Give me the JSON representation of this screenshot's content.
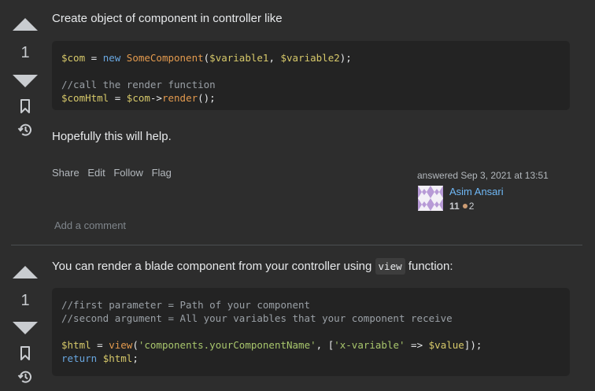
{
  "answers": [
    {
      "vote_count": "1",
      "intro_text": "Create object of component in controller like",
      "code_lines": [
        "$com = new SomeComponent($variable1, $variable2);",
        "",
        "//call the render function",
        "$comHtml = $com->render();"
      ],
      "outro_text": "Hopefully this will help.",
      "post_menu": [
        "Share",
        "Edit",
        "Follow",
        "Flag"
      ],
      "user": {
        "action": "answered Sep 3, 2021 at 13:51",
        "name": "Asim Ansari",
        "reputation": "11",
        "bronze_badges": "2"
      },
      "add_comment": "Add a comment"
    },
    {
      "vote_count": "1",
      "intro_before": "You can render a blade component from your controller using",
      "inline_code": "view",
      "intro_after": "function:",
      "code_lines": [
        "//first parameter = Path of your component",
        "//second argument = All your variables that your component receive",
        "",
        "$html = view('components.yourComponentName', ['x-variable' => $value]);",
        "return $html;"
      ]
    }
  ],
  "icons": {
    "upvote": "arrow-up-icon",
    "downvote": "arrow-down-icon",
    "bookmark": "bookmark-icon",
    "history": "history-icon"
  },
  "colors": {
    "background": "#2d2d2d",
    "code_background": "#232323",
    "link": "#6fb8f6",
    "bronze": "#cd9c73"
  }
}
